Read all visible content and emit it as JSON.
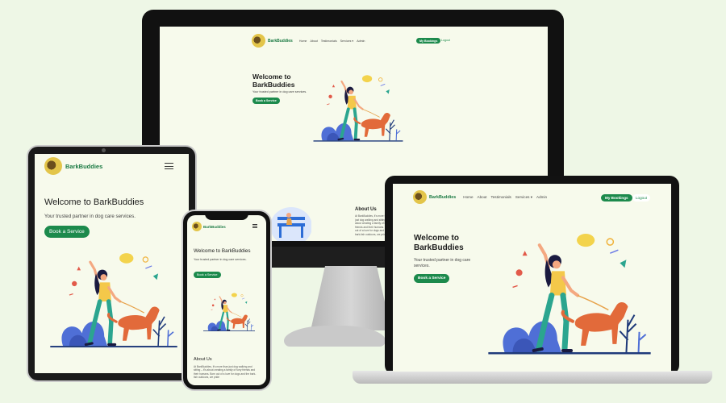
{
  "site": {
    "brand": "BarkBuddies",
    "nav_links": [
      "Home",
      "About",
      "Testimonials",
      "Services ▾",
      "Admin"
    ],
    "my_bookings": "My Bookings",
    "logout": "Logout",
    "hero_title_line1": "Welcome to",
    "hero_title_line2": "BarkBuddies",
    "hero_title_full": "Welcome to BarkBuddies",
    "hero_sub": "Your trusted partner in dog care services.",
    "cta": "Book a Service",
    "about_title": "About Us",
    "about_text": "At BarkBuddies, it's more than just dog walking and sitting – it's about creating a family of furry friends and their humans. Born out of a love for dogs and the bark-tish outdoors, we pride"
  },
  "colors": {
    "brand_green": "#1c8a4c",
    "page_bg": "#f7faec",
    "canvas_bg": "#eef7e6"
  }
}
